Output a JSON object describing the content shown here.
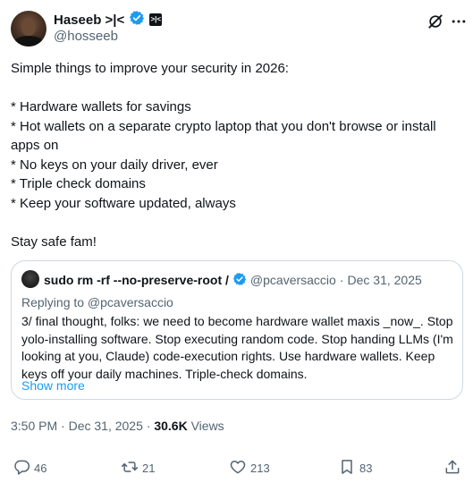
{
  "author": {
    "name": "Haseeb >|<",
    "badge_text": ">|<",
    "handle": "@hosseeb",
    "verified_color": "#1d9bf0"
  },
  "top_icons": [
    "grok-icon",
    "more-icon"
  ],
  "tweet": {
    "lines": [
      "Simple things to improve your security in 2026:",
      "",
      "* Hardware wallets for savings",
      "* Hot wallets on a separate crypto laptop that you don't browse or install apps on",
      "* No keys on your daily driver, ever",
      "* Triple check domains",
      "* Keep your software updated, always",
      "",
      "Stay safe fam!"
    ]
  },
  "quote": {
    "name": "sudo rm -rf --no-preserve-root /",
    "handle": "@pcaversaccio",
    "date": "Dec 31, 2025",
    "replying_to": "Replying to @pcaversaccio",
    "body": "3/ final thought, folks: we need to become hardware wallet maxis _now_. Stop yolo-installing software. Stop executing random code. Stop handing LLMs (I'm looking at you, Claude) code-execution rights. Use hardware wallets. Keep keys off your daily machines. Triple-check domains.",
    "show_more": "Show more"
  },
  "meta": {
    "time": "3:50 PM",
    "date": "Dec 31, 2025",
    "views_count": "30.6K",
    "views_label": "Views"
  },
  "actions": {
    "replies": "46",
    "reposts": "21",
    "likes": "213",
    "bookmarks": "83"
  },
  "colors": {
    "text": "#0f1419",
    "muted": "#536471",
    "link": "#1d9bf0",
    "border": "#cfd9de"
  }
}
